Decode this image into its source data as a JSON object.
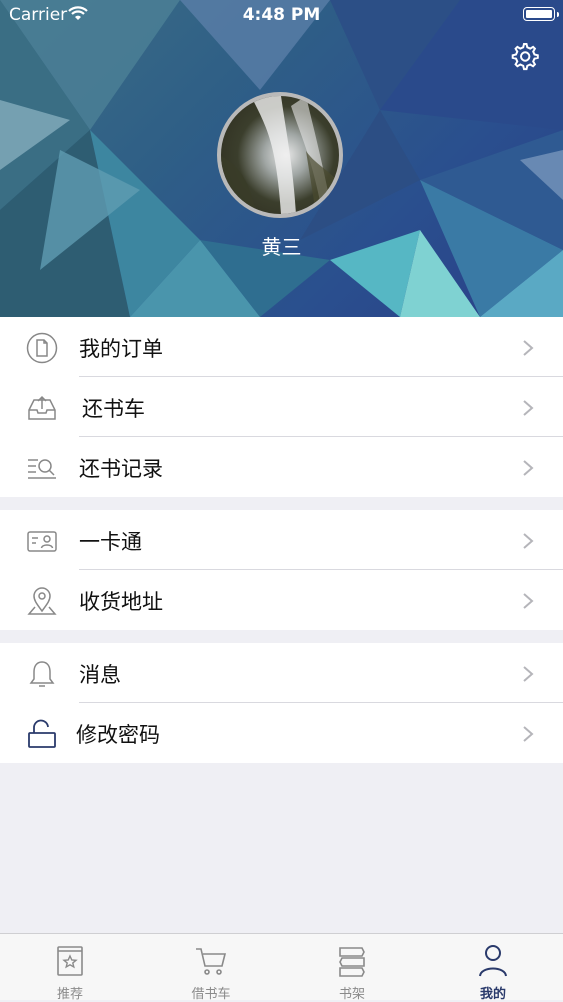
{
  "status_bar": {
    "carrier": "Carrier",
    "time": "4:48 PM"
  },
  "profile": {
    "username": "黄三"
  },
  "menu": {
    "group1": [
      {
        "label": "我的订单",
        "icon": "document-icon"
      },
      {
        "label": "还书车",
        "icon": "inbox-return-icon"
      },
      {
        "label": "还书记录",
        "icon": "list-search-icon"
      }
    ],
    "group2": [
      {
        "label": "一卡通",
        "icon": "id-card-icon"
      },
      {
        "label": "收货地址",
        "icon": "location-pin-icon"
      }
    ],
    "group3": [
      {
        "label": "消息",
        "icon": "bell-icon"
      },
      {
        "label": "修改密码",
        "icon": "unlock-icon"
      }
    ]
  },
  "tabbar": {
    "tabs": [
      {
        "label": "推荐",
        "icon": "book-star-icon"
      },
      {
        "label": "借书车",
        "icon": "cart-icon"
      },
      {
        "label": "书架",
        "icon": "books-icon"
      },
      {
        "label": "我的",
        "icon": "person-icon"
      }
    ],
    "active": 3
  },
  "colors": {
    "accent": "#2a3a6b",
    "header_blue": "#2f5f86",
    "chevron": "#b5b5ba"
  }
}
